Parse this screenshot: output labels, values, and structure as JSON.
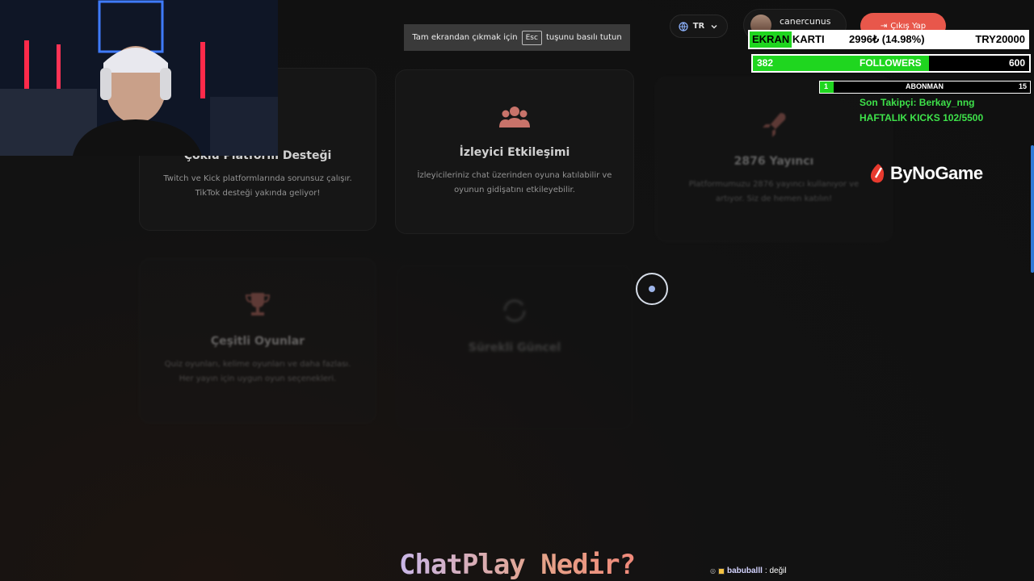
{
  "nav": {
    "language_label": "TR",
    "username": "canercunus",
    "logout_label": "Çıkış Yap",
    "fullscreen_hint_before": "Tam ekrandan çıkmak için",
    "fullscreen_hint_key": "Esc",
    "fullscreen_hint_after": "tuşunu basılı tutun"
  },
  "features": [
    {
      "icon": "layers-icon",
      "title": "Çoklu Platform Desteği",
      "desc_line1": "Twitch ve Kick platformlarında sorunsuz çalışır.",
      "desc_line2": "TikTok desteği yakında geliyor!"
    },
    {
      "icon": "users-icon",
      "title": "İzleyici Etkileşimi",
      "desc_line1": "İzleyicileriniz chat üzerinden oyuna katılabilir ve",
      "desc_line2": "oyunun gidişatını etkileyebilir."
    },
    {
      "icon": "rocket-icon",
      "title": "2876 Yayıncı",
      "desc_line1": "Platformumuzu 2876 yayıncı kullanıyor ve",
      "desc_line2": "artıyor. Siz de hemen katılın!"
    },
    {
      "icon": "trophy-icon",
      "title": "Çeşitli Oyunlar",
      "desc_line1": "Quiz oyunları, kelime oyunları ve daha fazlası.",
      "desc_line2": "Her yayın için uygun oyun seçenekleri."
    },
    {
      "icon": "refresh-icon",
      "title": "Sürekli Güncel",
      "desc_line1": "",
      "desc_line2": ""
    }
  ],
  "section_heading": "ChatPlay Nedir?",
  "overlay": {
    "gpu_goal": {
      "label": "EKRAN KARTI",
      "current": "2996₺ (14.98%)",
      "target": "TRY20000",
      "progress": 0.1498,
      "color": "#1fd61f"
    },
    "followers_goal": {
      "current": "382",
      "label": "FOLLOWERS",
      "target": "600",
      "progress": 0.6367,
      "color": "#1fd61f"
    },
    "sub_goal": {
      "current": "1",
      "label": "ABONMAN",
      "target": "15",
      "progress": 0.0667,
      "color": "#1fd61f"
    },
    "last_follower": "Son Takipçi: Berkay_nng",
    "weekly_kicks": "HAFTALIK KICKS 102/5500",
    "sponsor": "ByNoGame"
  },
  "chat": {
    "nick": "babuballl",
    "message": ": değil"
  },
  "colors": {
    "accent": "#e8574b",
    "overlay_green": "#3ee24a",
    "scroll": "#2f7ad8"
  }
}
